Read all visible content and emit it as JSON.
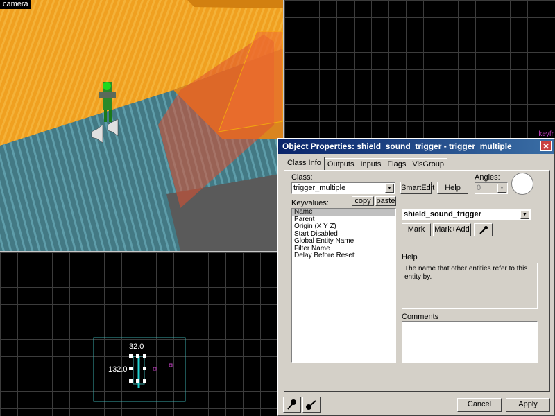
{
  "viewports": {
    "camera_label": "camera",
    "bottom_left": {
      "dim_top": "32.0",
      "dim_left": "132.0"
    },
    "top_right_corner_text": "keyfr"
  },
  "dialog": {
    "title": "Object Properties: shield_sound_trigger - trigger_multiple",
    "close_label": "✕",
    "tabs": [
      "Class Info",
      "Outputs",
      "Inputs",
      "Flags",
      "VisGroup"
    ],
    "active_tab": "Class Info",
    "class_label": "Class:",
    "class_value": "trigger_multiple",
    "smartedit_label": "SmartEdit",
    "help_button": "Help",
    "angles_label": "Angles:",
    "angles_value": "0",
    "keyvalues_label": "Keyvalues:",
    "copy_label": "copy",
    "paste_label": "paste",
    "keyvalues": [
      "Name",
      "Parent",
      "Origin (X Y Z)",
      "Start Disabled",
      "Global Entity Name",
      "Filter Name",
      "Delay Before Reset"
    ],
    "selected_key": "Name",
    "value": "shield_sound_trigger",
    "mark_label": "Mark",
    "markadd_label": "Mark+Add",
    "help_label": "Help",
    "help_text": "The name that other entities refer to this entity by.",
    "comments_label": "Comments",
    "cancel_label": "Cancel",
    "apply_label": "Apply"
  },
  "colors": {
    "wall_orange": "#f0a020",
    "floor_cyan": "#4aa8b8",
    "trigger_red": "#e05030",
    "grid_line": "#3c3c3c",
    "dialog_bg": "#d4d0c8",
    "title_bg": "#0a246a"
  }
}
